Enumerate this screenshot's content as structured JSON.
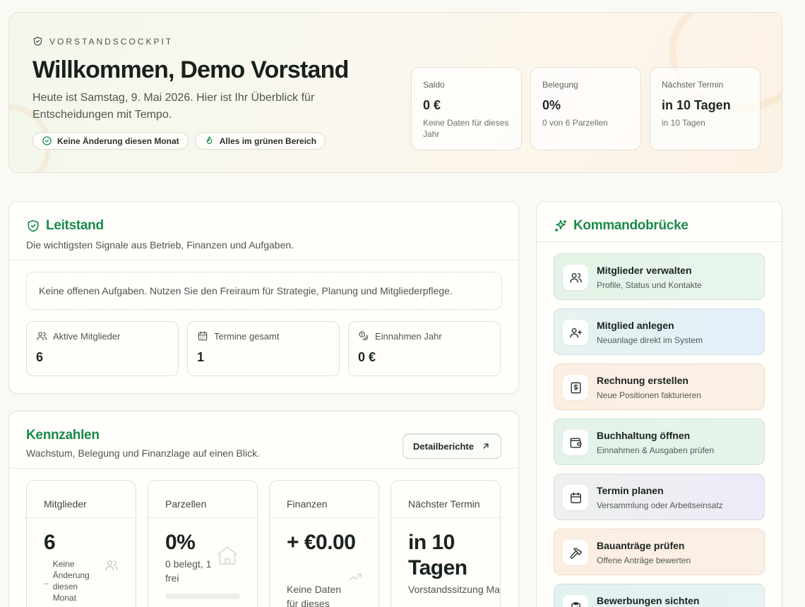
{
  "hero": {
    "eyebrow": "VORSTANDSCOCKPIT",
    "title": "Willkommen, Demo Vorstand",
    "lead": "Heute ist Samstag, 9. Mai 2026. Hier ist Ihr Überblick für Entscheidungen mit Tempo.",
    "chips": [
      {
        "label": "Keine Änderung diesen Monat",
        "icon": "check-circle-icon"
      },
      {
        "label": "Alles im grünen Bereich",
        "icon": "flame-icon"
      }
    ],
    "stats": [
      {
        "label": "Saldo",
        "value": "0 €",
        "sub": "Keine Daten für dieses Jahr"
      },
      {
        "label": "Belegung",
        "value": "0%",
        "sub": "0 von 6 Parzellen"
      },
      {
        "label": "Nächster Termin",
        "value": "in 10 Tagen",
        "sub": "in 10 Tagen"
      }
    ]
  },
  "leitstand": {
    "title": "Leitstand",
    "subtitle": "Die wichtigsten Signale aus Betrieb, Finanzen und Aufgaben.",
    "empty_text": "Keine offenen Aufgaben. Nutzen Sie den Freiraum für Strategie, Planung und Mitgliederpflege.",
    "stats": [
      {
        "label": "Aktive Mitglieder",
        "value": "6",
        "icon": "users-icon"
      },
      {
        "label": "Termine gesamt",
        "value": "1",
        "icon": "calendar-icon"
      },
      {
        "label": "Einnahmen Jahr",
        "value": "0 €",
        "icon": "coins-icon"
      }
    ]
  },
  "kennzahlen": {
    "title": "Kennzahlen",
    "subtitle": "Wachstum, Belegung und Finanzlage auf einen Blick.",
    "button_label": "Detailberichte",
    "kpis": [
      {
        "label": "Mitglieder",
        "value": "6",
        "sub": "Keine Änderung diesen Monat"
      },
      {
        "label": "Parzellen",
        "value": "0%",
        "sub": "0 belegt, 1 frei"
      },
      {
        "label": "Finanzen",
        "value": "+ €0.00",
        "sub": "Keine Daten für dieses"
      },
      {
        "label": "Nächster Termin",
        "value": "in 10 Tagen",
        "sub": "Vorstandssitzung Mai"
      }
    ]
  },
  "kommando": {
    "title": "Kommandobrücke",
    "actions": [
      {
        "title": "Mitglieder verwalten",
        "sub": "Profile, Status und Kontakte",
        "icon": "users-icon"
      },
      {
        "title": "Mitglied anlegen",
        "sub": "Neuanlage direkt im System",
        "icon": "user-plus-icon"
      },
      {
        "title": "Rechnung erstellen",
        "sub": "Neue Positionen fakturieren",
        "icon": "invoice-icon"
      },
      {
        "title": "Buchhaltung öffnen",
        "sub": "Einnahmen & Ausgaben prüfen",
        "icon": "wallet-icon"
      },
      {
        "title": "Termin planen",
        "sub": "Versammlung oder Arbeitseinsatz",
        "icon": "calendar-icon"
      },
      {
        "title": "Bauanträge prüfen",
        "sub": "Offene Anträge bewerten",
        "icon": "hammer-icon"
      },
      {
        "title": "Bewerbungen sichten",
        "sub": "",
        "icon": "clipboard-icon"
      }
    ]
  },
  "colors": {
    "accent": "#1a8a4a",
    "background": "#fbf9f3"
  }
}
